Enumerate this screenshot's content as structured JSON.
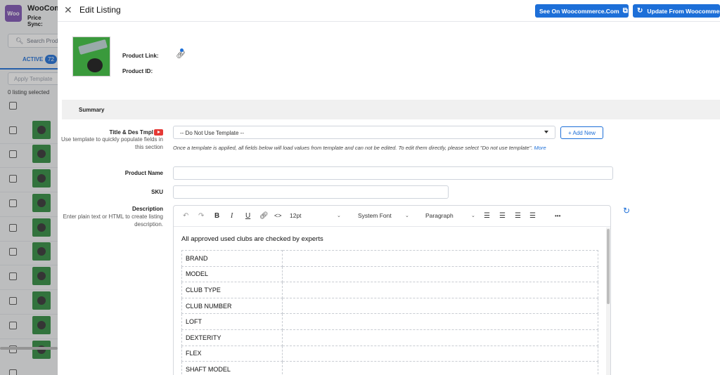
{
  "background_app": {
    "logo_text": "Woo",
    "title": "WooCom",
    "subtitle": "Price Sync:",
    "search_placeholder": "Search Prod",
    "tab_label": "ACTIVE",
    "tab_count": "72",
    "apply_placeholder": "Apply Template",
    "selected_text": "0 listing selected"
  },
  "header": {
    "title": "Edit Listing",
    "see_on_label": "See On Woocommerce.Com",
    "update_label": "Update From Woocommerce"
  },
  "product": {
    "link_label": "Product Link:",
    "id_label": "Product ID:"
  },
  "summary": {
    "title": "Summary"
  },
  "fields": {
    "template": {
      "label": "Title & Des Tmpl",
      "help": "Use template to quickly populate fields in this section",
      "value": "-- Do Not Use Template --",
      "add_new": "+ Add New",
      "note": "Once a template is applied, all fields below will load values from template and can not be edited. To edit them directly, please select \"Do not use template\".",
      "more": "More"
    },
    "product_name": {
      "label": "Product Name",
      "value": ""
    },
    "sku": {
      "label": "SKU",
      "value": ""
    },
    "description": {
      "label": "Description",
      "help": "Enter plain text or HTML to create listing description."
    }
  },
  "editor": {
    "font_size": "12pt",
    "font_family": "System Font",
    "block_format": "Paragraph",
    "more": "•••",
    "intro": "All approved used clubs are checked by experts",
    "rows": [
      {
        "key": "BRAND",
        "value": ""
      },
      {
        "key": "MODEL",
        "value": ""
      },
      {
        "key": "CLUB TYPE",
        "value": ""
      },
      {
        "key": "CLUB NUMBER",
        "value": ""
      },
      {
        "key": "LOFT",
        "value": ""
      },
      {
        "key": "DEXTERITY",
        "value": ""
      },
      {
        "key": "FLEX",
        "value": ""
      },
      {
        "key": "SHAFT MODEL",
        "value": ""
      }
    ]
  },
  "icons": {
    "close": "close-icon",
    "external": "external-link-icon",
    "sync": "sync-icon",
    "link": "link-icon",
    "youtube": "youtube-icon",
    "refresh": "refresh-icon"
  }
}
